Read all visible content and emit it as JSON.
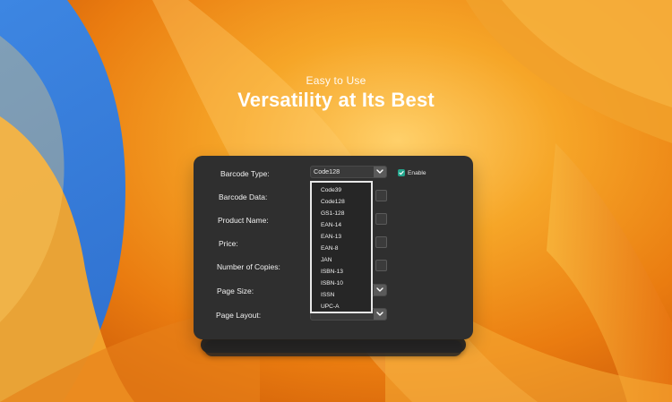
{
  "hero": {
    "subtitle": "Easy to Use",
    "title": "Versatility at Its Best"
  },
  "form": {
    "barcode_type_label": "Barcode Type:",
    "barcode_type_value": "Code128",
    "enable_label": "Enable",
    "enable_checked": true,
    "barcode_data_label": "Barcode Data:",
    "product_name_label": "Product Name:",
    "price_label": "Price:",
    "number_of_copies_label": "Number of Copies:",
    "page_size_label": "Page Size:",
    "page_layout_label": "Page Layout:"
  },
  "dropdown": {
    "options": [
      "Code39",
      "Code128",
      "GS1-128",
      "EAN-14",
      "EAN-13",
      "EAN-8",
      "JAN",
      "ISBN-13",
      "ISBN-10",
      "ISSN",
      "UPC-A"
    ]
  },
  "colors": {
    "panel": "#2f2f2f",
    "accent_check": "#24a48c",
    "background_blue": "#2f73cf",
    "background_orange": "#f39a24"
  },
  "icons": {
    "select_arrow": "chevron-down-icon",
    "check": "check-icon"
  }
}
